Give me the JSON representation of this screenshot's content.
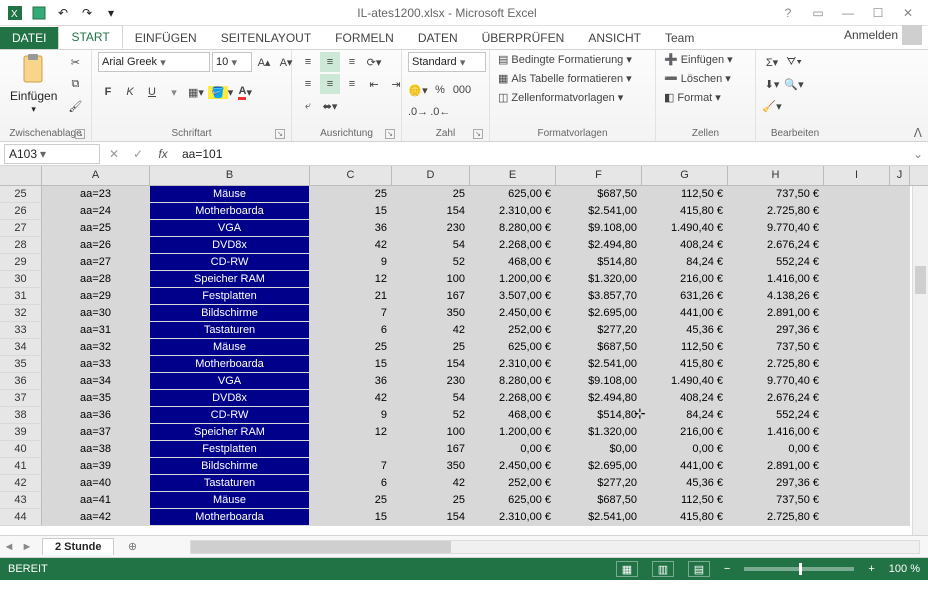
{
  "app": {
    "title": "IL-ates1200.xlsx - Microsoft Excel",
    "anmelden": "Anmelden"
  },
  "tabs": {
    "datei": "DATEI",
    "start": "START",
    "einfuegen": "EINFÜGEN",
    "seitenlayout": "SEITENLAYOUT",
    "formeln": "FORMELN",
    "daten": "DATEN",
    "ueberpruefen": "ÜBERPRÜFEN",
    "ansicht": "ANSICHT",
    "team": "Team"
  },
  "ribbon": {
    "group_zwischenablage": "Zwischenablage",
    "einfuegen_btn": "Einfügen",
    "group_schriftart": "Schriftart",
    "font_name": "Arial Greek",
    "font_size": "10",
    "bold": "F",
    "italic": "K",
    "underline": "U",
    "group_ausrichtung": "Ausrichtung",
    "group_zahl": "Zahl",
    "number_format": "Standard",
    "group_formatvorlagen": "Formatvorlagen",
    "bedingte": "Bedingte Formatierung",
    "als_tabelle": "Als Tabelle formatieren",
    "zellenformat": "Zellenformatvorlagen",
    "group_zellen": "Zellen",
    "z_einfuegen": "Einfügen",
    "z_loeschen": "Löschen",
    "z_format": "Format",
    "group_bearbeiten": "Bearbeiten"
  },
  "formula_bar": {
    "name_box": "A103",
    "formula": "aa=101"
  },
  "columns": [
    "A",
    "B",
    "C",
    "D",
    "E",
    "F",
    "G",
    "H",
    "I",
    "J"
  ],
  "colwidths": [
    "wA",
    "wB",
    "wC",
    "wD",
    "wE",
    "wF",
    "wG",
    "wH",
    "wI",
    "wJ"
  ],
  "rows": [
    {
      "n": 25,
      "a": "aa=23",
      "b": "Mäuse",
      "c": "25",
      "d": "25",
      "e": "625,00 €",
      "f": "$687,50",
      "g": "112,50 €",
      "h": "737,50 €"
    },
    {
      "n": 26,
      "a": "aa=24",
      "b": "Motherboarda",
      "c": "15",
      "d": "154",
      "e": "2.310,00 €",
      "f": "$2.541,00",
      "g": "415,80 €",
      "h": "2.725,80 €"
    },
    {
      "n": 27,
      "a": "aa=25",
      "b": "VGA",
      "c": "36",
      "d": "230",
      "e": "8.280,00 €",
      "f": "$9.108,00",
      "g": "1.490,40 €",
      "h": "9.770,40 €"
    },
    {
      "n": 28,
      "a": "aa=26",
      "b": "DVD8x",
      "c": "42",
      "d": "54",
      "e": "2.268,00 €",
      "f": "$2.494,80",
      "g": "408,24 €",
      "h": "2.676,24 €"
    },
    {
      "n": 29,
      "a": "aa=27",
      "b": "CD-RW",
      "c": "9",
      "d": "52",
      "e": "468,00 €",
      "f": "$514,80",
      "g": "84,24 €",
      "h": "552,24 €"
    },
    {
      "n": 30,
      "a": "aa=28",
      "b": "Speicher RAM",
      "c": "12",
      "d": "100",
      "e": "1.200,00 €",
      "f": "$1.320,00",
      "g": "216,00 €",
      "h": "1.416,00 €"
    },
    {
      "n": 31,
      "a": "aa=29",
      "b": "Festplatten",
      "c": "21",
      "d": "167",
      "e": "3.507,00 €",
      "f": "$3.857,70",
      "g": "631,26 €",
      "h": "4.138,26 €"
    },
    {
      "n": 32,
      "a": "aa=30",
      "b": "Bildschirme",
      "c": "7",
      "d": "350",
      "e": "2.450,00 €",
      "f": "$2.695,00",
      "g": "441,00 €",
      "h": "2.891,00 €"
    },
    {
      "n": 33,
      "a": "aa=31",
      "b": "Tastaturen",
      "c": "6",
      "d": "42",
      "e": "252,00 €",
      "f": "$277,20",
      "g": "45,36 €",
      "h": "297,36 €"
    },
    {
      "n": 34,
      "a": "aa=32",
      "b": "Mäuse",
      "c": "25",
      "d": "25",
      "e": "625,00 €",
      "f": "$687,50",
      "g": "112,50 €",
      "h": "737,50 €"
    },
    {
      "n": 35,
      "a": "aa=33",
      "b": "Motherboarda",
      "c": "15",
      "d": "154",
      "e": "2.310,00 €",
      "f": "$2.541,00",
      "g": "415,80 €",
      "h": "2.725,80 €"
    },
    {
      "n": 36,
      "a": "aa=34",
      "b": "VGA",
      "c": "36",
      "d": "230",
      "e": "8.280,00 €",
      "f": "$9.108,00",
      "g": "1.490,40 €",
      "h": "9.770,40 €"
    },
    {
      "n": 37,
      "a": "aa=35",
      "b": "DVD8x",
      "c": "42",
      "d": "54",
      "e": "2.268,00 €",
      "f": "$2.494,80",
      "g": "408,24 €",
      "h": "2.676,24 €"
    },
    {
      "n": 38,
      "a": "aa=36",
      "b": "CD-RW",
      "c": "9",
      "d": "52",
      "e": "468,00 €",
      "f": "$514,80",
      "g": "84,24 €",
      "h": "552,24 €"
    },
    {
      "n": 39,
      "a": "aa=37",
      "b": "Speicher RAM",
      "c": "12",
      "d": "100",
      "e": "1.200,00 €",
      "f": "$1.320,00",
      "g": "216,00 €",
      "h": "1.416,00 €"
    },
    {
      "n": 40,
      "a": "aa=38",
      "b": "Festplatten",
      "c": "",
      "d": "167",
      "e": "0,00 €",
      "f": "$0,00",
      "g": "0,00 €",
      "h": "0,00 €"
    },
    {
      "n": 41,
      "a": "aa=39",
      "b": "Bildschirme",
      "c": "7",
      "d": "350",
      "e": "2.450,00 €",
      "f": "$2.695,00",
      "g": "441,00 €",
      "h": "2.891,00 €"
    },
    {
      "n": 42,
      "a": "aa=40",
      "b": "Tastaturen",
      "c": "6",
      "d": "42",
      "e": "252,00 €",
      "f": "$277,20",
      "g": "45,36 €",
      "h": "297,36 €"
    },
    {
      "n": 43,
      "a": "aa=41",
      "b": "Mäuse",
      "c": "25",
      "d": "25",
      "e": "625,00 €",
      "f": "$687,50",
      "g": "112,50 €",
      "h": "737,50 €"
    },
    {
      "n": 44,
      "a": "aa=42",
      "b": "Motherboarda",
      "c": "15",
      "d": "154",
      "e": "2.310,00 €",
      "f": "$2.541,00",
      "g": "415,80 €",
      "h": "2.725,80 €"
    }
  ],
  "sheet": {
    "name": "2 Stunde"
  },
  "status": {
    "ready": "BEREIT",
    "zoom": "100 %"
  }
}
